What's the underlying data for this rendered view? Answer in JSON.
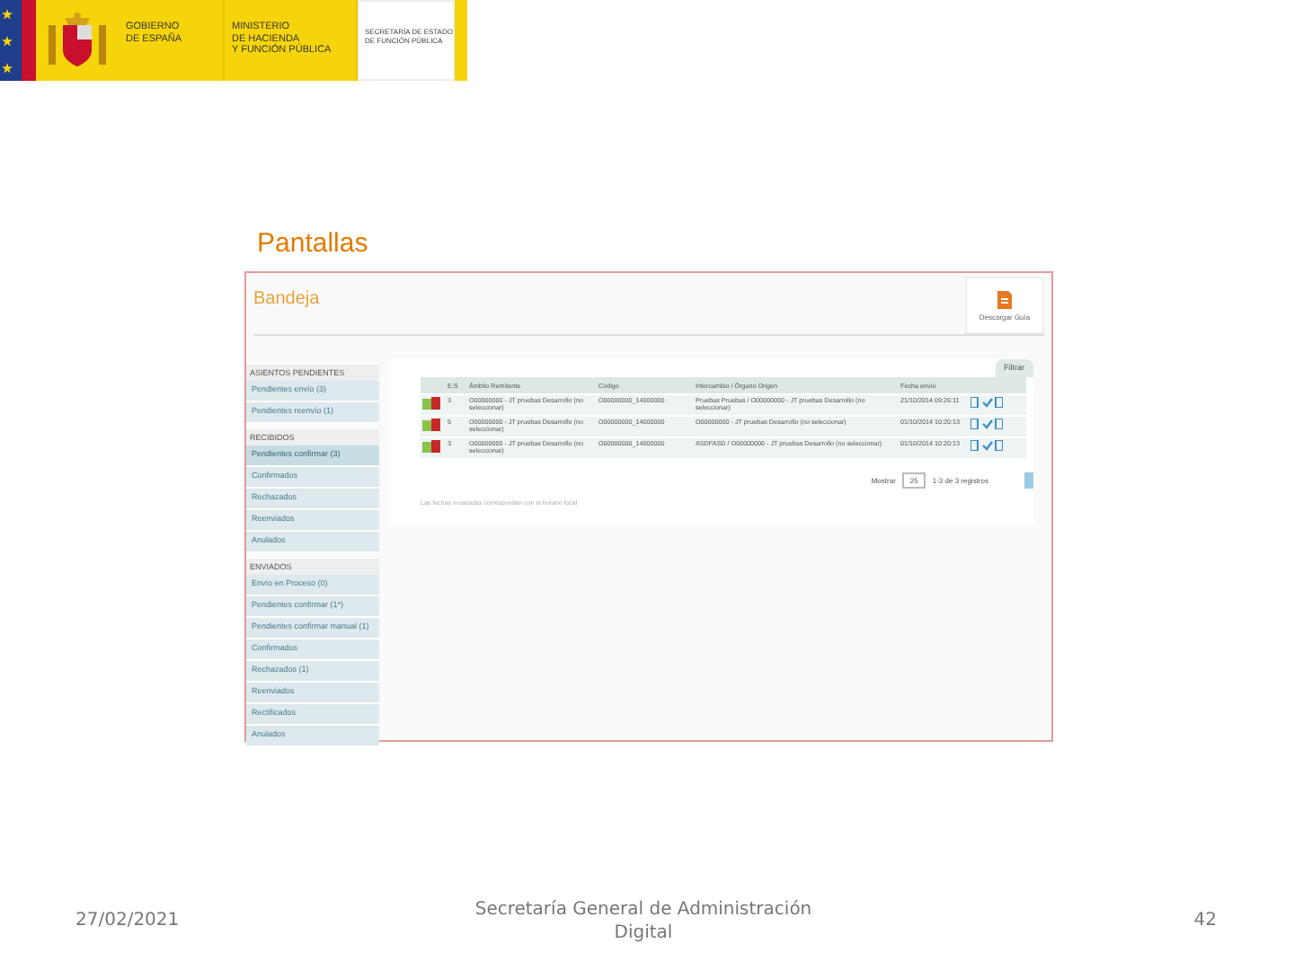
{
  "header": {
    "gov": [
      "GOBIERNO",
      "DE ESPAÑA"
    ],
    "ministry": [
      "MINISTERIO",
      "DE HACIENDA",
      "Y FUNCIÓN PÚBLICA"
    ],
    "secretariat": [
      "SECRETARÍA DE ESTADO",
      "DE FUNCIÓN PÚBLICA"
    ]
  },
  "slide_title": "Pantallas",
  "app": {
    "title": "Bandeja",
    "download_label": "Descargar Guía",
    "filter_label": "Filtrar",
    "sidebar": [
      {
        "heading": "ASIENTOS PENDIENTES",
        "items": [
          {
            "label": "Pendientes envío (3)",
            "selected": false
          },
          {
            "label": "Pendientes reenvío (1)",
            "selected": false
          }
        ]
      },
      {
        "heading": "RECIBIDOS",
        "items": [
          {
            "label": "Pendientes confirmar (3)",
            "selected": true
          },
          {
            "label": "Confirmados",
            "selected": false
          },
          {
            "label": "Rechazados",
            "selected": false
          },
          {
            "label": "Reenviados",
            "selected": false
          },
          {
            "label": "Anulados",
            "selected": false
          }
        ]
      },
      {
        "heading": "ENVIADOS",
        "items": [
          {
            "label": "Envío en Proceso (0)",
            "selected": false
          },
          {
            "label": "Pendientes confirmar (1*)",
            "selected": false
          },
          {
            "label": "Pendientes confirmar manual (1)",
            "selected": false
          },
          {
            "label": "Confirmados",
            "selected": false
          },
          {
            "label": "Rechazados (1)",
            "selected": false
          },
          {
            "label": "Reenviados",
            "selected": false
          },
          {
            "label": "Rectificados",
            "selected": false
          },
          {
            "label": "Anulados",
            "selected": false
          }
        ]
      }
    ],
    "table": {
      "columns": [
        "E.S",
        "Ámbito Remitente",
        "Código",
        "Intercambio / Órgano Origen",
        "Fecha envío"
      ],
      "rows": [
        {
          "es": "3",
          "ambito": "O00000000 - JT pruebas Desarrollo (no seleccionar)",
          "codigo": "O00000000_14000000",
          "intercambio": "Pruebas Pruebas / O00000000 - JT pruebas Desarrollo (no seleccionar)",
          "fecha": "21/10/2014 09:26:11"
        },
        {
          "es": "5",
          "ambito": "O00000000 - JT pruebas Desarrollo (no seleccionar)",
          "codigo": "O00000000_14000000",
          "intercambio": "O00000000 - JT pruebas Desarrollo (no seleccionar)",
          "fecha": "01/10/2014 10:20:13"
        },
        {
          "es": "3",
          "ambito": "O00000000 - JT pruebas Desarrollo (no seleccionar)",
          "codigo": "O00000000_14000000",
          "intercambio": "ASDFASD / O00000000 - JT pruebas Desarrollo (no seleccionar)",
          "fecha": "01/10/2014 10:20:13"
        }
      ]
    },
    "pagination": {
      "show_label": "Mostrar",
      "page_size": "25",
      "range": "1-3 de 3 registros"
    },
    "note": "Las fechas mostradas corresponden con el horario local"
  },
  "footer": {
    "date": "27/02/2021",
    "org": "Secretaría General de Administración Digital",
    "page": "42"
  }
}
